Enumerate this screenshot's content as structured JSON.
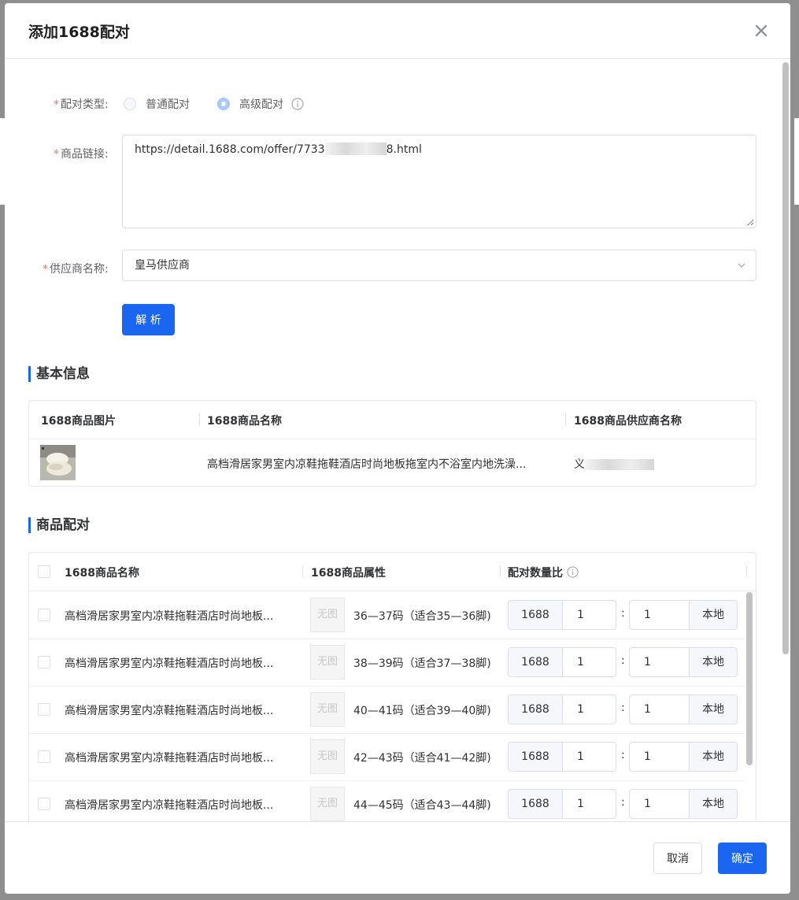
{
  "dialog": {
    "title": "添加1688配对"
  },
  "form": {
    "pair_type_label": "配对类型:",
    "radio_normal": "普通配对",
    "radio_advanced": "高级配对",
    "link_label": "商品链接:",
    "link_value_prefix": "https://detail.1688.com/offer/7733",
    "link_value_suffix": "8.html",
    "supplier_label": "供应商名称:",
    "supplier_value": "皇马供应商",
    "parse_button": "解 析",
    "required_mark": "*"
  },
  "basic_info": {
    "section_title": "基本信息",
    "columns": [
      "1688商品图片",
      "1688商品名称",
      "1688商品供应商名称"
    ],
    "row": {
      "product_name": "高档滑居家男室内凉鞋拖鞋酒店时尚地板拖室内不浴室内地洗澡...",
      "supplier_visible": "义"
    }
  },
  "pairing": {
    "section_title": "商品配对",
    "columns": [
      "1688商品名称",
      "1688商品属性",
      "配对数量比"
    ],
    "no_image_text": "无图",
    "left_addon": "1688",
    "right_addon": "本地",
    "colon": ":",
    "rows": [
      {
        "name": "高档滑居家男室内凉鞋拖鞋酒店时尚地板...",
        "attr": "36—37码（适合35—36脚)",
        "left_qty": "1",
        "right_qty": "1"
      },
      {
        "name": "高档滑居家男室内凉鞋拖鞋酒店时尚地板...",
        "attr": "38—39码（适合37—38脚)",
        "left_qty": "1",
        "right_qty": "1"
      },
      {
        "name": "高档滑居家男室内凉鞋拖鞋酒店时尚地板...",
        "attr": "40—41码（适合39—40脚)",
        "left_qty": "1",
        "right_qty": "1"
      },
      {
        "name": "高档滑居家男室内凉鞋拖鞋酒店时尚地板...",
        "attr": "42—43码（适合41—42脚)",
        "left_qty": "1",
        "right_qty": "1"
      },
      {
        "name": "高档滑居家男室内凉鞋拖鞋酒店时尚地板...",
        "attr": "44—45码（适合43—44脚)",
        "left_qty": "1",
        "right_qty": "1"
      }
    ]
  },
  "footer": {
    "cancel": "取消",
    "confirm": "确定"
  },
  "colors": {
    "primary": "#1a66f0",
    "required": "#f56c6c"
  },
  "icons": {
    "close": "close-icon",
    "info": "info-icon",
    "dropdown": "chevron-down-icon"
  }
}
